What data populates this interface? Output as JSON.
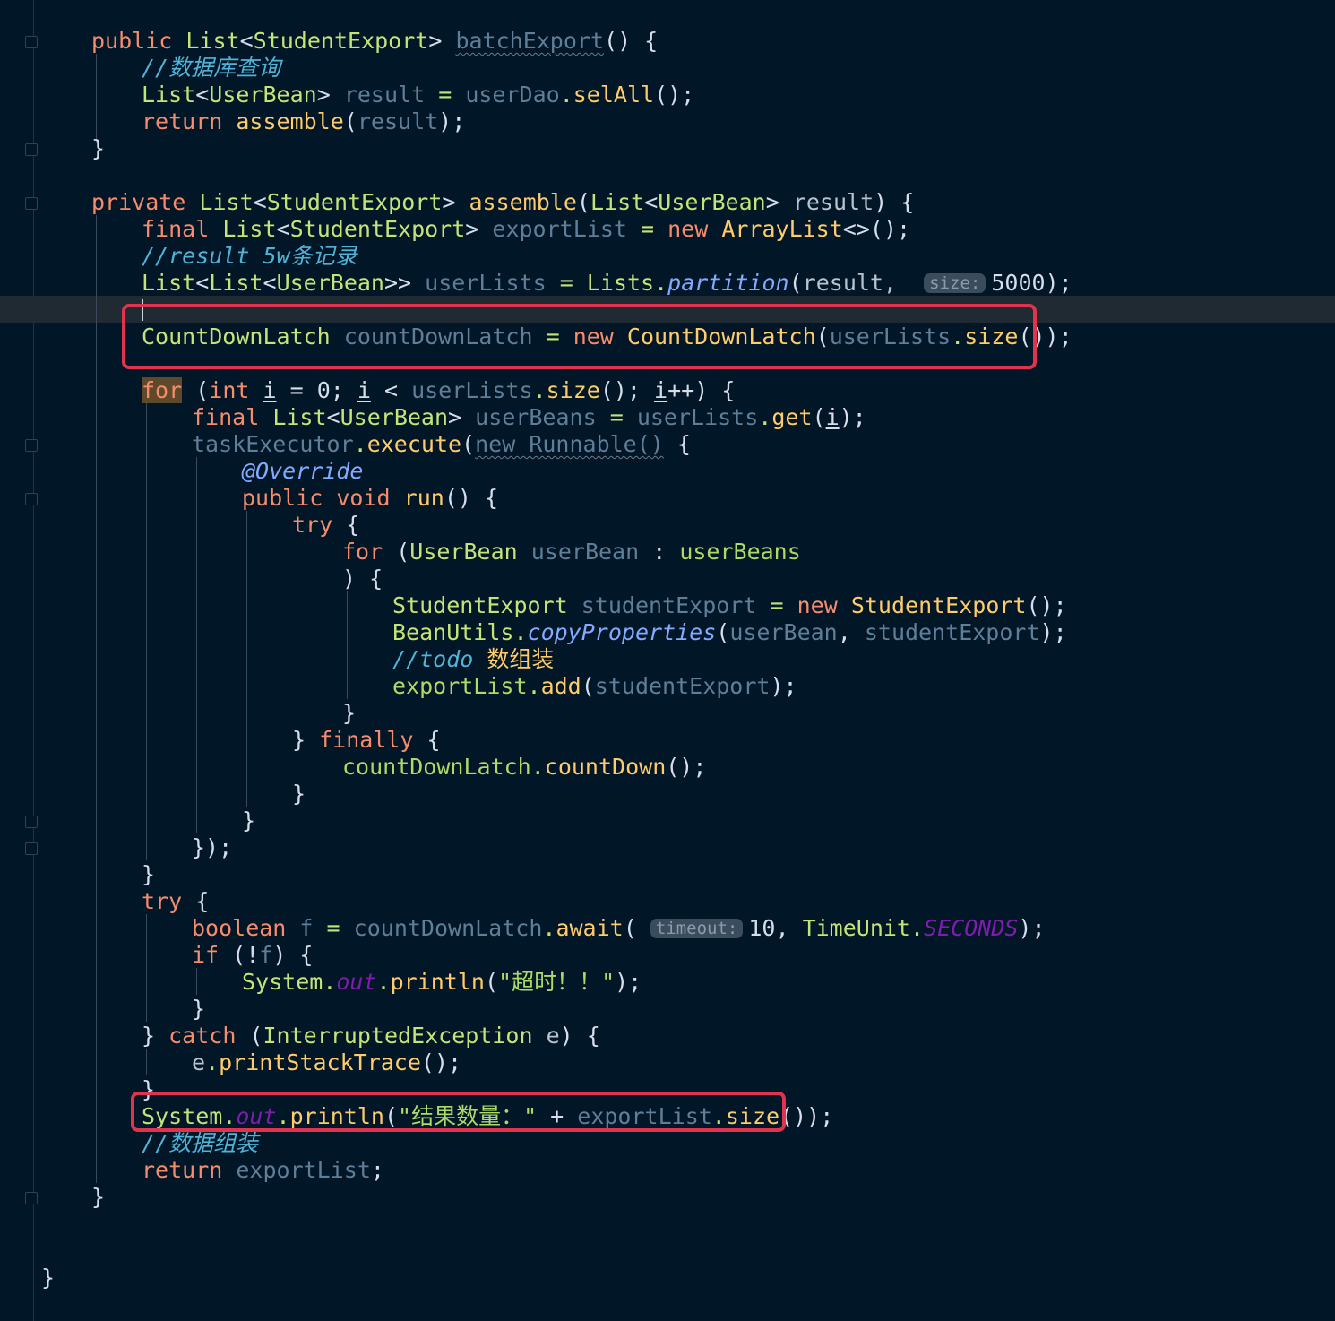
{
  "code": {
    "l1": {
      "kw": "public",
      "type": "List",
      "lt": "<",
      "gen": "StudentExport",
      "gt": ">",
      "name": "batchExport",
      "tail": "() {"
    },
    "l2": {
      "comment": "//数据库查询"
    },
    "l3": {
      "type": "List",
      "lt": "<",
      "gen": "UserBean",
      "gt": ">",
      "var": "result",
      "eq": "=",
      "obj": "userDao",
      "dot": ".",
      "call": "selAll",
      "tail": "();"
    },
    "l4": {
      "kw": "return",
      "call": "assemble",
      "open": "(",
      "arg": "result",
      "close": ");"
    },
    "l5": {
      "brace": "}"
    },
    "l7": {
      "kw": "private",
      "type": "List",
      "lt": "<",
      "gen": "StudentExport",
      "gt": ">",
      "name": "assemble",
      "open": "(",
      "ptype": "List",
      "plt": "<",
      "pgen": "UserBean",
      "pgt": ">",
      "param": "result",
      "tail": ") {"
    },
    "l8": {
      "kw": "final",
      "type": "List",
      "lt": "<",
      "gen": "StudentExport",
      "gt": ">",
      "var": "exportList",
      "eq": "=",
      "new": "new",
      "ctor": "ArrayList",
      "tail": "<>();"
    },
    "l9": {
      "comment": "//result 5w条记录"
    },
    "l10": {
      "type": "List",
      "lt": "<",
      "inner": "List",
      "lt2": "<",
      "gen": "UserBean",
      "gt": ">>",
      "var": "userLists",
      "eq": "=",
      "cls": "Lists",
      "dot": ".",
      "call": "partition",
      "open": "(",
      "arg": "result,",
      "hint": "size:",
      "num": "5000",
      "close": ");"
    },
    "l12": {
      "type": "CountDownLatch",
      "var": "countDownLatch",
      "eq": "=",
      "new": "new",
      "ctor": "CountDownLatch",
      "open": "(",
      "obj": "userLists",
      "dot": ".",
      "call": "size",
      "close": "());"
    },
    "l14": {
      "kw": "for",
      "p1": " (",
      "int": "int",
      "i": "i",
      "eq": " = 0; ",
      "i2": "i",
      "lt": " < ",
      "obj": "userLists",
      "dot": ".",
      "call": "size",
      "p2": "(); ",
      "i3": "i",
      "tail": "++) {"
    },
    "l15": {
      "kw": "final",
      "type": "List",
      "lt": "<",
      "gen": "UserBean",
      "gt": ">",
      "var": "userBeans",
      "eq": "=",
      "obj": "userLists",
      "dot": ".",
      "call": "get",
      "open": "(",
      "i": "i",
      "close": ");"
    },
    "l16": {
      "obj": "taskExecutor",
      "dot": ".",
      "call": "execute",
      "open": "(",
      "anon": "new Runnable()",
      "tail": " {"
    },
    "l17": {
      "annotation": "@Override"
    },
    "l18": {
      "kw": "public",
      "kw2": "void",
      "name": "run",
      "tail": "() {"
    },
    "l19": {
      "kw": "try",
      "tail": " {"
    },
    "l20": {
      "kw": "for",
      "open": " (",
      "type": "UserBean",
      "var": "userBean",
      "colon": " : ",
      "iter": "userBeans"
    },
    "l21": {
      "text": ") {"
    },
    "l22": {
      "type": "StudentExport",
      "var": "studentExport",
      "eq": "=",
      "new": "new",
      "ctor": "StudentExport",
      "tail": "();"
    },
    "l23": {
      "cls": "BeanUtils",
      "dot": ".",
      "call": "copyProperties",
      "open": "(",
      "a1": "userBean",
      "comma": ", ",
      "a2": "studentExport",
      "close": ");"
    },
    "l24": {
      "comment": "//todo",
      "comment2": " 数组装"
    },
    "l25": {
      "obj": "exportList",
      "dot": ".",
      "call": "add",
      "open": "(",
      "arg": "studentExport",
      "close": ");"
    },
    "l26": {
      "brace": "}"
    },
    "l27": {
      "b": "} ",
      "kw": "finally",
      "tail": " {"
    },
    "l28": {
      "obj": "countDownLatch",
      "dot": ".",
      "call": "countDown",
      "tail": "();"
    },
    "l29": {
      "brace": "}"
    },
    "l30": {
      "brace": "}"
    },
    "l31": {
      "text": "});"
    },
    "l32": {
      "brace": "}"
    },
    "l33": {
      "kw": "try",
      "tail": " {"
    },
    "l34": {
      "kw": "boolean",
      "var": "f",
      "eq": "=",
      "obj": "countDownLatch",
      "dot": ".",
      "call": "await",
      "open": "(",
      "hint": "timeout:",
      "num": "10",
      "comma": ", ",
      "cls": "TimeUnit",
      "dot2": ".",
      "const": "SECONDS",
      "close": ");"
    },
    "l35": {
      "kw": "if",
      "open": " (!",
      "var": "f",
      "tail": ") {"
    },
    "l36": {
      "cls": "System",
      "dot": ".",
      "field": "out",
      "dot2": ".",
      "call": "println",
      "open": "(",
      "str": "\"超时！！\"",
      "close": ");"
    },
    "l37": {
      "brace": "}"
    },
    "l38": {
      "b": "} ",
      "kw": "catch",
      "open": " (",
      "type": "InterruptedException",
      "var": " e",
      "tail": ") {"
    },
    "l39": {
      "obj": "e",
      "dot": ".",
      "call": "printStackTrace",
      "tail": "();"
    },
    "l40": {
      "brace": "}"
    },
    "l41": {
      "cls": "System",
      "dot": ".",
      "field": "out",
      "dot2": ".",
      "call": "println",
      "open": "(",
      "str": "\"结果数量：\"",
      "plus": " + ",
      "obj": "exportList",
      "dot3": ".",
      "call2": "size",
      "close": "());"
    },
    "l42": {
      "comment": "//数据组装"
    },
    "l43": {
      "kw": "return",
      "var": "exportList",
      "semi": ";"
    },
    "l44": {
      "brace": "}"
    },
    "l47": {
      "brace": "}"
    }
  },
  "colors": {
    "background": "#011627",
    "highlight_box": "#e0334d"
  }
}
